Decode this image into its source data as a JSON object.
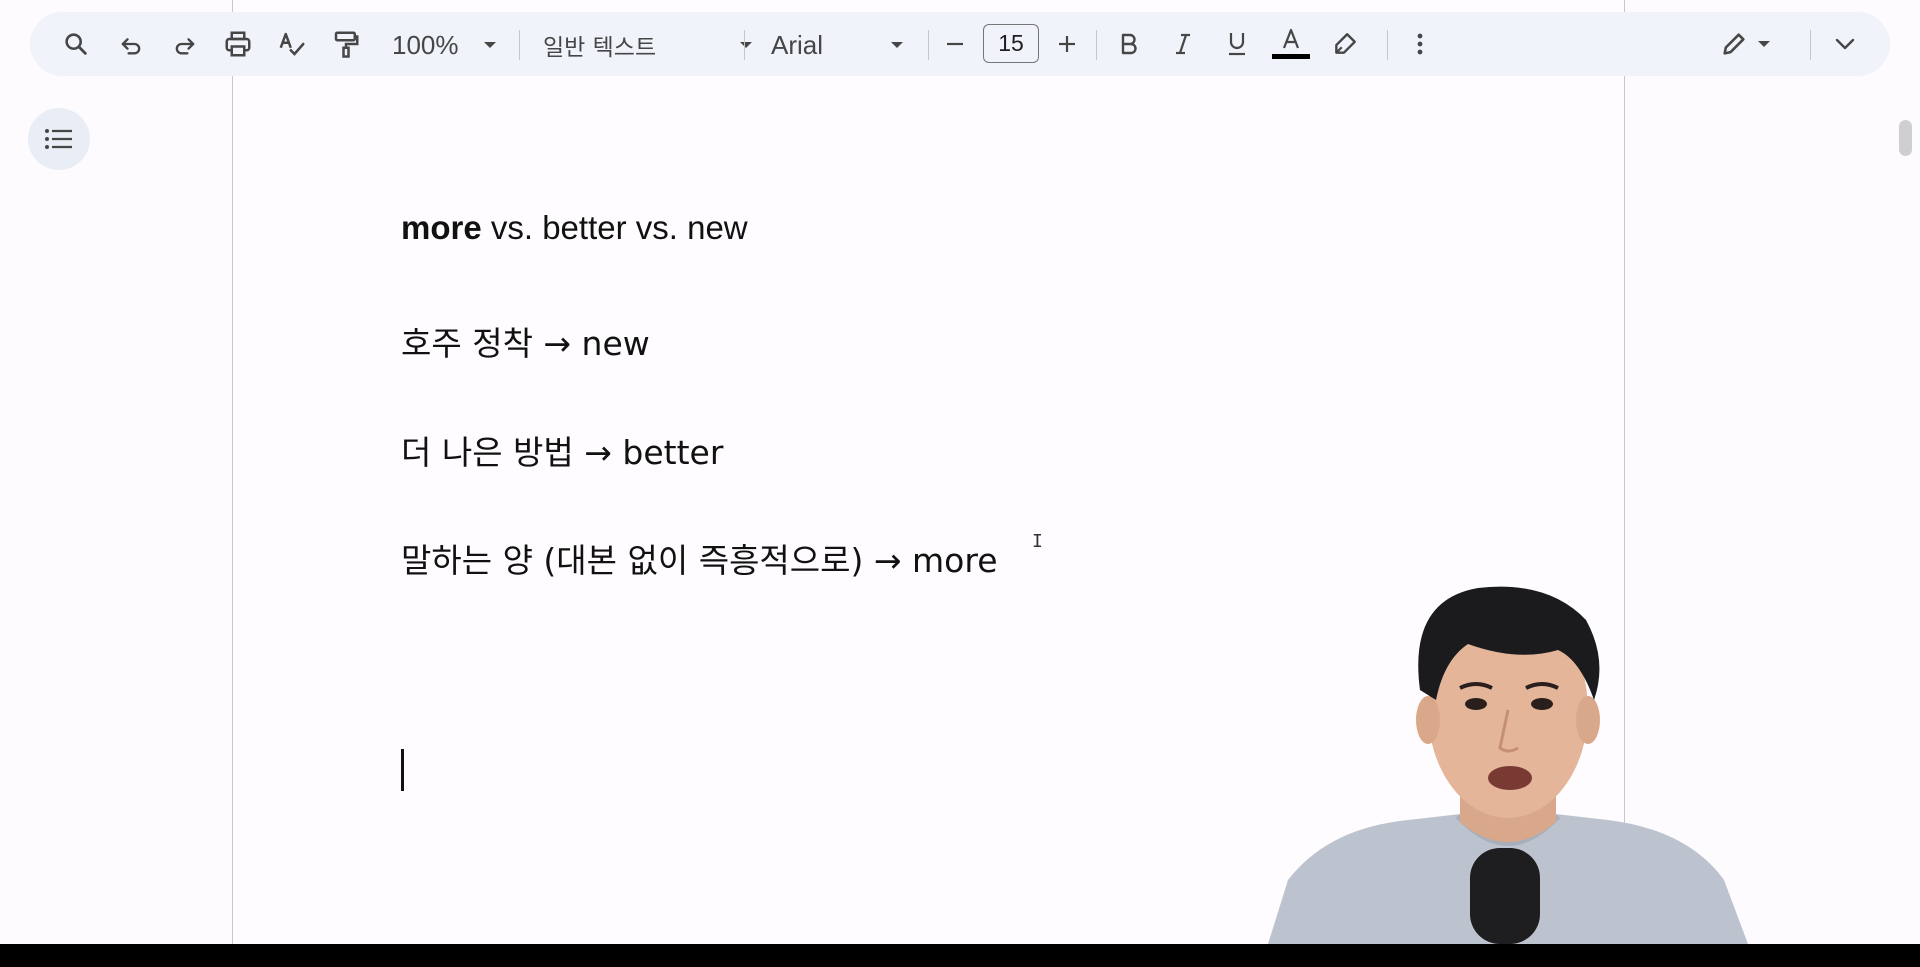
{
  "toolbar": {
    "zoom": "100%",
    "style": "일반 텍스트",
    "font": "Arial",
    "font_size": "15",
    "text_color": "#000000"
  },
  "document": {
    "line1_bold": "more",
    "line1_rest": " vs. better vs. new",
    "line2": "호주 정착 → new",
    "line3": "더 나은 방법 → better",
    "line4": "말하는 양 (대본 없이 즉흥적으로) → more"
  },
  "icons": [
    "search-icon",
    "undo-icon",
    "redo-icon",
    "print-icon",
    "spellcheck-icon",
    "paint-format-icon",
    "bold-icon",
    "italic-icon",
    "underline-icon",
    "text-color-icon",
    "highlight-icon",
    "more-vert-icon",
    "edit-mode-icon",
    "chevron-down-icon",
    "outline-icon"
  ]
}
